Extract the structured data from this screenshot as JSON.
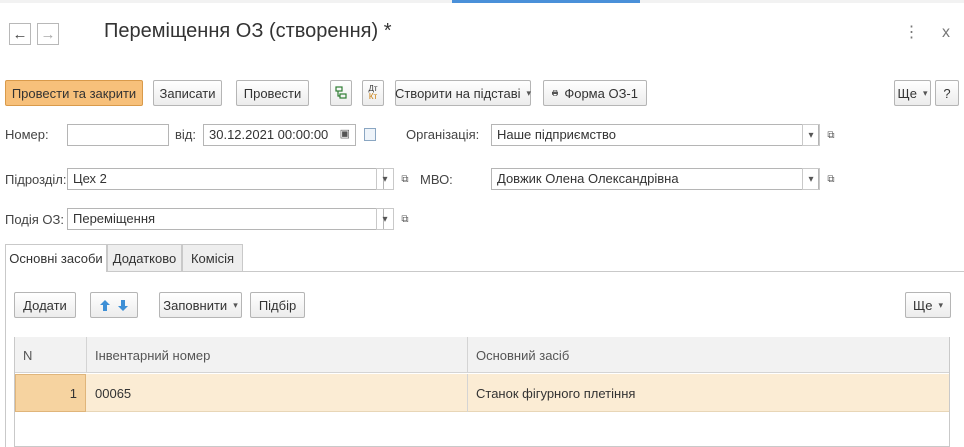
{
  "window": {
    "title": "Переміщення ОЗ (створення) *",
    "nav_back": "←",
    "nav_forward": "→",
    "menu_glyph": "⋮",
    "close_glyph": "x"
  },
  "toolbar": {
    "post_close": "Провести та закрити",
    "save": "Записати",
    "post": "Провести",
    "dt_kt_top": "Дт",
    "dt_kt_bottom": "Кт",
    "create_basis": "Створити на підставі",
    "print_form": "Форма ОЗ-1",
    "more": "Ще",
    "help": "?",
    "caret": "▾"
  },
  "form": {
    "number_label": "Номер:",
    "number_value": "",
    "date_label": "від:",
    "date_value": "30.12.2021 00:00:00",
    "org_label": "Організація:",
    "org_value": "Наше підприємство",
    "dept_label": "Підрозділ:",
    "dept_value": "Цех 2",
    "mvo_label": "МВО:",
    "mvo_value": "Довжик Олена Олександрівна",
    "event_label": "Подія ОЗ:",
    "event_value": "Переміщення"
  },
  "tabs": [
    {
      "label": "Основні засоби",
      "active": true
    },
    {
      "label": "Додатково",
      "active": false
    },
    {
      "label": "Комісія",
      "active": false
    }
  ],
  "table_toolbar": {
    "add": "Додати",
    "fill": "Заповнити",
    "pick": "Підбір",
    "more": "Ще"
  },
  "table": {
    "columns": [
      "N",
      "Інвентарний номер",
      "Основний засіб"
    ],
    "rows": [
      {
        "n": "1",
        "inventory_number": "00065",
        "asset": "Станок фігурного плетіння"
      }
    ]
  },
  "colors": {
    "primary_button": "#f7c07a",
    "selected_row": "#fbecd4",
    "arrow_blue": "#3d8fd6"
  }
}
